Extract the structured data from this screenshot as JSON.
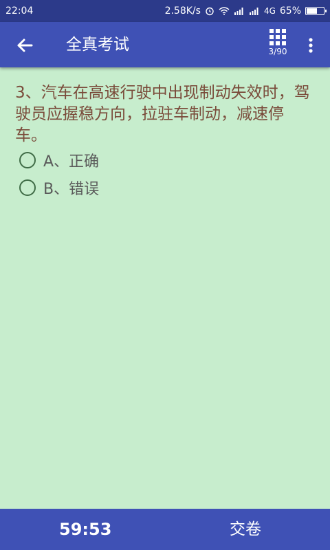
{
  "status_bar": {
    "time": "22:04",
    "net_speed": "2.58K/s",
    "network": "4G",
    "battery": "65%",
    "battery_level": 0.65
  },
  "app_bar": {
    "back_icon": "arrow-back-icon",
    "title": "全真考试",
    "grid_icon": "grid-icon",
    "question_counter": "3/90",
    "more_icon": "more-vert-icon"
  },
  "question": {
    "text": "3、汽车在高速行驶中出现制动失效时，驾驶员应握稳方向，拉驻车制动，减速停车。",
    "options": [
      {
        "label": "A、正确"
      },
      {
        "label": "B、错误"
      }
    ]
  },
  "bottom_bar": {
    "timer": "59:53",
    "submit_label": "交卷"
  },
  "colors": {
    "primary": "#3f51b5",
    "status_bar": "#2c3a8a",
    "background": "#c7edcd",
    "question_text": "#7a4b3a"
  }
}
